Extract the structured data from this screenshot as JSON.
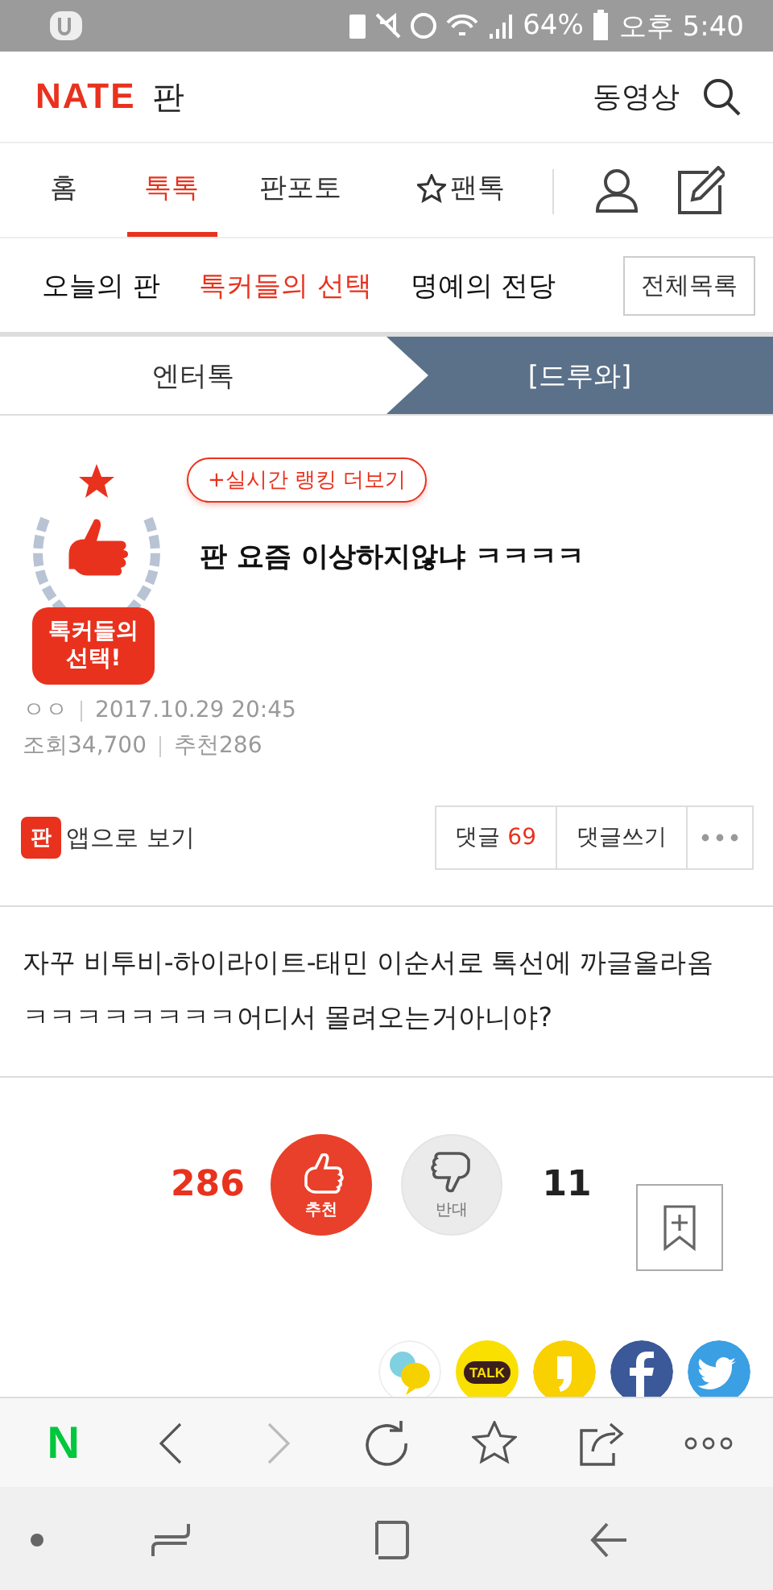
{
  "status_bar": {
    "battery": "64%",
    "time": "오후 5:40"
  },
  "header": {
    "logo": "NATE",
    "section": "판",
    "video_link": "동영상"
  },
  "nav_tabs": [
    {
      "label": "홈",
      "selected": false,
      "kind": "text"
    },
    {
      "label": "톡톡",
      "selected": true,
      "kind": "text"
    },
    {
      "label": "판포토",
      "selected": false,
      "kind": "text"
    },
    {
      "label": "팬톡",
      "selected": false,
      "kind": "star"
    }
  ],
  "sub_nav": [
    {
      "label": "오늘의 판",
      "selected": false
    },
    {
      "label": "톡커들의 선택",
      "selected": true
    },
    {
      "label": "명예의 전당",
      "selected": false
    }
  ],
  "all_list_button": "전체목록",
  "breadcrumb": [
    {
      "label": "엔터톡",
      "selected": false
    },
    {
      "label": "[드루와]",
      "selected": true
    }
  ],
  "article": {
    "badge": [
      "톡커들의",
      "선택!"
    ],
    "ranking_button": "+실시간 랭킹 더보기",
    "title": "판 요즘 이상하지않냐 ㅋㅋㅋㅋ",
    "author": "ㅇㅇ",
    "date": "2017.10.29 20:45",
    "views": "조회34,700",
    "recommends": "추천286",
    "app_icon": "판",
    "app_link": "앱으로 보기",
    "comment_label": "댓글",
    "comment_count": "69",
    "write_comment": "댓글쓰기",
    "body": "자꾸 비투비-하이라이트-태민 이순서로 톡선에 까글올라옴 ㅋㅋㅋㅋㅋㅋㅋㅋ어디서 몰려오는거아니야?"
  },
  "votes": {
    "up_count": "286",
    "up_label": "추천",
    "down_label": "반대",
    "down_count": "11"
  },
  "share": [
    {
      "kind": "bubbles"
    },
    {
      "kind": "talk",
      "label": "TALK"
    },
    {
      "kind": "story"
    },
    {
      "kind": "facebook"
    },
    {
      "kind": "twitter"
    }
  ],
  "toolbar": [
    {
      "kind": "logo",
      "label": "N",
      "disabled": false
    },
    {
      "kind": "back",
      "disabled": false
    },
    {
      "kind": "forward",
      "disabled": true
    },
    {
      "kind": "reload",
      "disabled": false
    },
    {
      "kind": "star",
      "disabled": false
    },
    {
      "kind": "share",
      "disabled": false
    },
    {
      "kind": "more",
      "disabled": false
    }
  ]
}
